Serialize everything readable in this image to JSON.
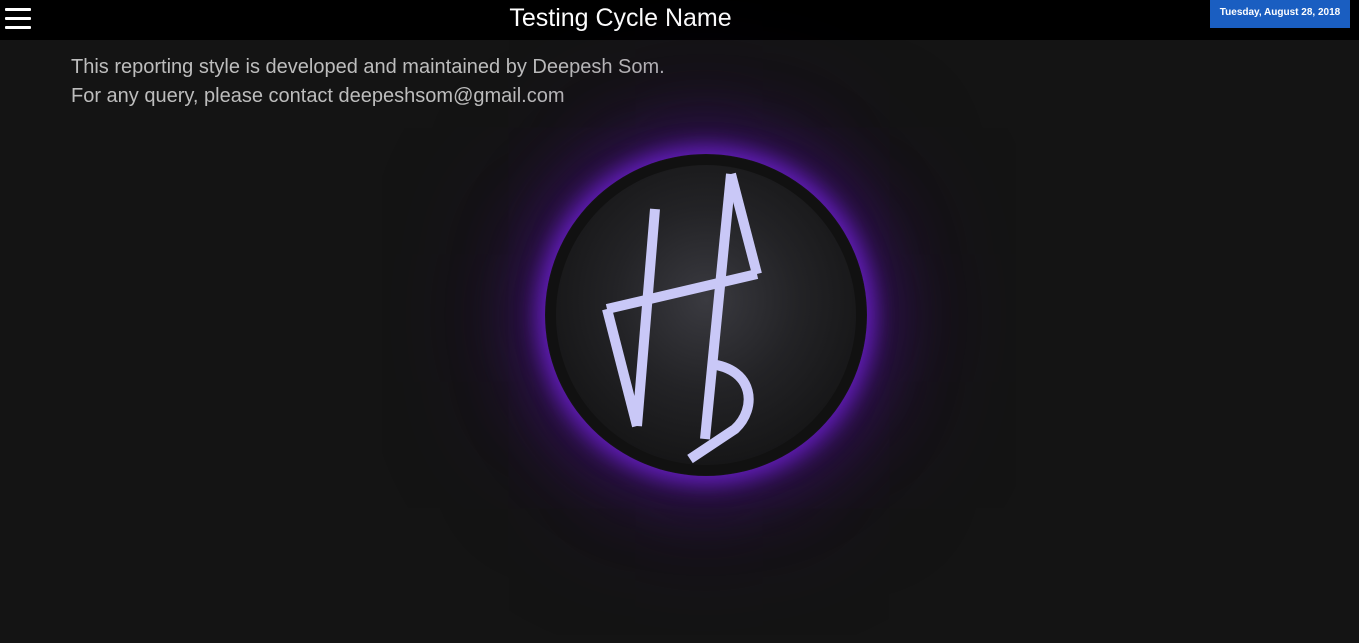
{
  "header": {
    "title": "Testing Cycle Name",
    "date": "Tuesday, August 28, 2018",
    "menu_icon": "hamburger-menu-icon"
  },
  "info": {
    "line1": "This reporting style is developed and maintained by Deepesh Som.",
    "line2": "For any query, please contact deepeshsom@gmail.com"
  },
  "logo": {
    "icon": "monogram-logo-icon",
    "glow_color": "#6a1fc8",
    "glyph_color": "#c9c8f7"
  },
  "colors": {
    "background": "#141414",
    "header_background": "#000000",
    "date_badge": "#1a5ec1",
    "text": "#bdbdbd"
  }
}
